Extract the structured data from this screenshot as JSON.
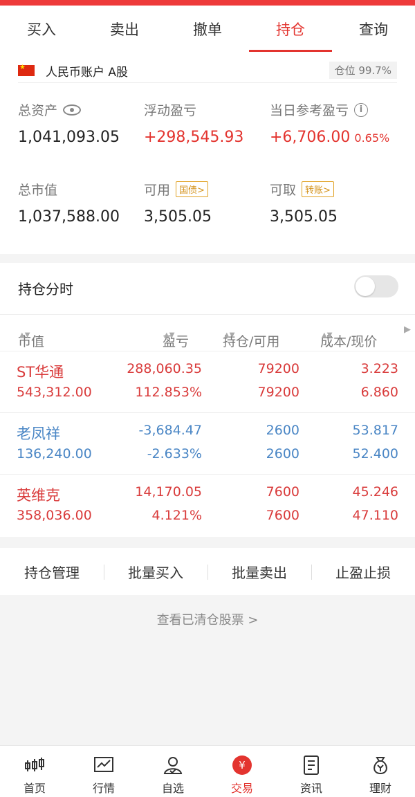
{
  "tabs": [
    {
      "label": "买入"
    },
    {
      "label": "卖出"
    },
    {
      "label": "撤单"
    },
    {
      "label": "持仓",
      "active": true
    },
    {
      "label": "查询"
    }
  ],
  "account": {
    "name": "人民币账户 A股",
    "position_ratio": "仓位 99.7%",
    "total_assets_label": "总资产",
    "total_assets": "1,041,093.05",
    "floating_pl_label": "浮动盈亏",
    "floating_pl": "+298,545.93",
    "daily_pl_label": "当日参考盈亏",
    "daily_pl": "+6,706.00",
    "daily_pl_pct": "0.65%",
    "market_value_label": "总市值",
    "market_value": "1,037,588.00",
    "available_label": "可用",
    "available_tag": "国债>",
    "available": "3,505.05",
    "withdrawable_label": "可取",
    "withdrawable_tag": "转账>",
    "withdrawable": "3,505.05"
  },
  "holdings": {
    "title": "持仓分时",
    "columns": [
      "市值",
      "盈亏",
      "持仓/可用",
      "成本/现价"
    ],
    "rows": [
      {
        "name": "ST华通",
        "value": "543,312.00",
        "pl": "288,060.35",
        "pl_pct": "112.853%",
        "hold": "79200",
        "avail": "79200",
        "cost": "3.223",
        "price": "6.860"
      },
      {
        "name": "老凤祥",
        "value": "136,240.00",
        "pl": "-3,684.47",
        "pl_pct": "-2.633%",
        "hold": "2600",
        "avail": "2600",
        "cost": "53.817",
        "price": "52.400"
      },
      {
        "name": "英维克",
        "value": "358,036.00",
        "pl": "14,170.05",
        "pl_pct": "4.121%",
        "hold": "7600",
        "avail": "7600",
        "cost": "45.246",
        "price": "47.110"
      }
    ]
  },
  "actions": [
    "持仓管理",
    "批量买入",
    "批量卖出",
    "止盈止损"
  ],
  "cleared_link": "查看已清仓股票 >",
  "bottom_nav": [
    {
      "label": "首页",
      "icon": "candlestick-icon"
    },
    {
      "label": "行情",
      "icon": "chart-icon"
    },
    {
      "label": "自选",
      "icon": "person-icon"
    },
    {
      "label": "交易",
      "icon": "yuan-icon",
      "active": true
    },
    {
      "label": "资讯",
      "icon": "document-icon"
    },
    {
      "label": "理财",
      "icon": "money-bag-icon"
    }
  ],
  "colors": {
    "red": "#e3342f",
    "blue": "#4a86c5",
    "gold": "#d4921a"
  }
}
